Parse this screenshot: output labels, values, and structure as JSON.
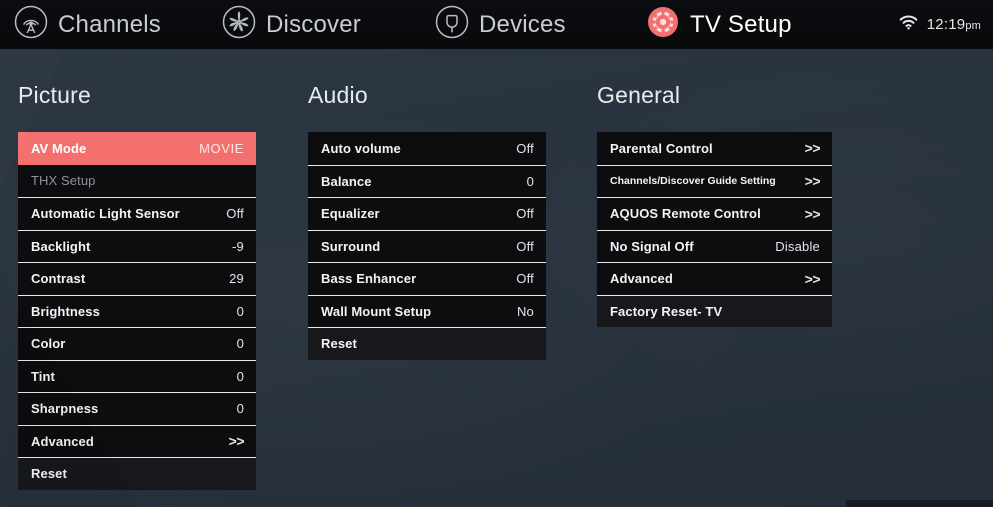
{
  "header": {
    "nav": [
      {
        "id": "channels",
        "label": "Channels",
        "icon": "broadcast-antenna-icon",
        "active": false
      },
      {
        "id": "discover",
        "label": "Discover",
        "icon": "pinwheel-flower-icon",
        "active": false
      },
      {
        "id": "devices",
        "label": "Devices",
        "icon": "plug-connector-icon",
        "active": false
      },
      {
        "id": "tv-setup",
        "label": "TV Setup",
        "icon": "gear-icon",
        "active": true
      }
    ],
    "status": {
      "wifi_icon": "wifi-icon",
      "time": "12:19",
      "meridiem": "pm"
    }
  },
  "columns": [
    {
      "id": "picture",
      "title": "Picture",
      "rows": [
        {
          "label": "AV Mode",
          "value": "MOVIE",
          "state": "selected"
        },
        {
          "label": "THX Setup",
          "value": "",
          "state": "dim"
        },
        {
          "label": "Automatic Light Sensor",
          "value": "Off",
          "state": "normal"
        },
        {
          "label": "Backlight",
          "value": "-9",
          "state": "normal"
        },
        {
          "label": "Contrast",
          "value": "29",
          "state": "normal"
        },
        {
          "label": "Brightness",
          "value": "0",
          "state": "normal"
        },
        {
          "label": "Color",
          "value": "0",
          "state": "normal"
        },
        {
          "label": "Tint",
          "value": "0",
          "state": "normal"
        },
        {
          "label": "Sharpness",
          "value": "0",
          "state": "normal"
        },
        {
          "label": "Advanced",
          "value": ">>",
          "state": "normal"
        },
        {
          "label": "Reset",
          "value": "",
          "state": "reset"
        }
      ]
    },
    {
      "id": "audio",
      "title": "Audio",
      "rows": [
        {
          "label": "Auto volume",
          "value": "Off",
          "state": "normal"
        },
        {
          "label": "Balance",
          "value": "0",
          "state": "normal"
        },
        {
          "label": "Equalizer",
          "value": "Off",
          "state": "normal"
        },
        {
          "label": "Surround",
          "value": "Off",
          "state": "normal"
        },
        {
          "label": "Bass Enhancer",
          "value": "Off",
          "state": "normal"
        },
        {
          "label": "Wall Mount Setup",
          "value": "No",
          "state": "normal"
        },
        {
          "label": "Reset",
          "value": "",
          "state": "reset"
        }
      ]
    },
    {
      "id": "general",
      "title": "General",
      "rows": [
        {
          "label": "Parental Control",
          "value": ">>",
          "state": "normal"
        },
        {
          "label": "Channels/Discover Guide Setting",
          "value": ">>",
          "state": "small"
        },
        {
          "label": "AQUOS Remote Control",
          "value": ">>",
          "state": "normal"
        },
        {
          "label": "No Signal Off",
          "value": "Disable",
          "state": "normal"
        },
        {
          "label": "Advanced",
          "value": ">>",
          "state": "normal"
        },
        {
          "label": "Factory Reset- TV",
          "value": "",
          "state": "reset"
        }
      ]
    }
  ],
  "colors": {
    "accent": "#f4706f",
    "header_bg": "#0a0b0d",
    "row_bg": "#0d0d10",
    "page_bg": "#283340",
    "separator": "#e8eaec"
  }
}
